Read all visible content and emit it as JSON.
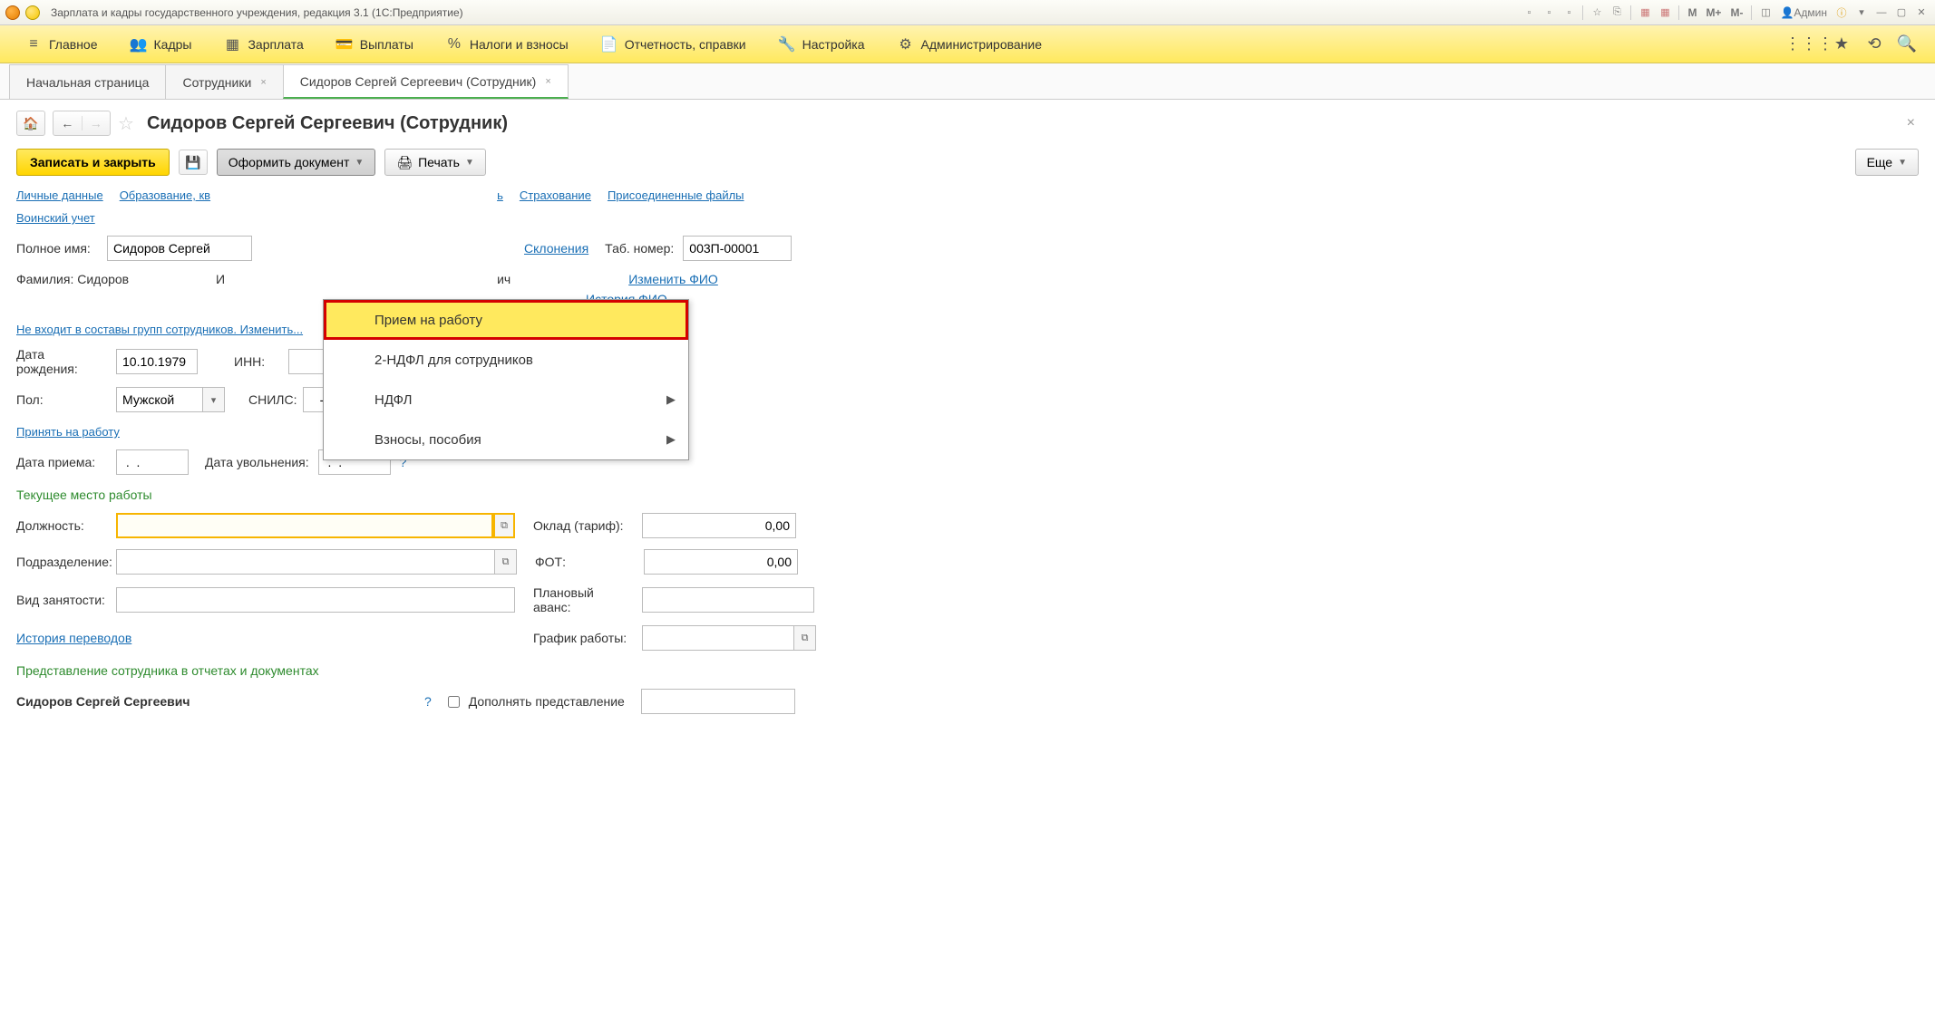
{
  "titlebar": {
    "title": "Зарплата и кадры государственного учреждения, редакция 3.1  (1С:Предприятие)",
    "user_label": "Админ",
    "m": "M",
    "mp": "M+",
    "mm": "M-"
  },
  "mainmenu": {
    "items": [
      {
        "icon": "≡",
        "label": "Главное"
      },
      {
        "icon": "👥",
        "label": "Кадры"
      },
      {
        "icon": "▦",
        "label": "Зарплата"
      },
      {
        "icon": "💳",
        "label": "Выплаты"
      },
      {
        "icon": "%",
        "label": "Налоги и взносы"
      },
      {
        "icon": "📄",
        "label": "Отчетность, справки"
      },
      {
        "icon": "🔧",
        "label": "Настройка"
      },
      {
        "icon": "⚙",
        "label": "Администрирование"
      }
    ],
    "right_icons": [
      "⋮⋮⋮",
      "★",
      "⟲",
      "🔍"
    ]
  },
  "tabs": [
    {
      "label": "Начальная страница",
      "closable": false,
      "active": false
    },
    {
      "label": "Сотрудники",
      "closable": true,
      "active": false
    },
    {
      "label": "Сидоров Сергей Сергеевич (Сотрудник)",
      "closable": true,
      "active": true
    }
  ],
  "page": {
    "title": "Сидоров Сергей Сергеевич (Сотрудник)",
    "btn_save_close": "Записать и закрыть",
    "btn_doc": "Оформить документ",
    "btn_print": "Печать",
    "btn_more": "Еще"
  },
  "dropdown": {
    "items": [
      {
        "label": "Прием на работу",
        "hi": true
      },
      {
        "label": "2-НДФЛ для сотрудников"
      },
      {
        "label": "НДФЛ",
        "sub": true
      },
      {
        "label": "Взносы, пособия",
        "sub": true
      }
    ]
  },
  "links": {
    "personal": "Личные данные",
    "edu": "Образование, кв",
    "family_end": "ь",
    "insurance": "Страхование",
    "files": "Присоединенные файлы",
    "military": "Воинский учет",
    "declensions": "Склонения",
    "change_fio": "Изменить ФИО",
    "history_fio": "История ФИО",
    "groups": "Не входит в составы групп сотрудников. Изменить...",
    "hire": "Принять на работу",
    "transfers": "История переводов"
  },
  "form": {
    "fullname_lbl": "Полное имя:",
    "fullname_val": "Сидоров Сергей",
    "tabnum_lbl": "Таб. номер:",
    "tabnum_val": "003П-00001",
    "surname_lbl": "Фамилия: Сидоров",
    "name_lbl": "И",
    "patr_end": "ич",
    "dob_lbl": "Дата рождения:",
    "dob_val": "10.10.1979",
    "inn_lbl": "ИНН:",
    "inn_val": "",
    "gender_lbl": "Пол:",
    "gender_val": "Мужской",
    "snils_lbl": "СНИЛС:",
    "snils_val": "   -   -",
    "hiredate_lbl": "Дата приема:",
    "hiredate_val": " .  .",
    "firedate_lbl": "Дата увольнения:",
    "firedate_val": " .  .",
    "workplace_hdr": "Текущее место работы",
    "position_lbl": "Должность:",
    "salary_lbl": "Оклад (тариф):",
    "salary_val": "0,00",
    "dept_lbl": "Подразделение:",
    "fot_lbl": "ФОТ:",
    "fot_val": "0,00",
    "emptype_lbl": "Вид занятости:",
    "advance_lbl": "Плановый аванс:",
    "schedule_lbl": "График работы:",
    "repr_hdr": "Представление сотрудника в отчетах и документах",
    "repr_val": "Сидоров Сергей Сергеевич",
    "extend_lbl": "Дополнять представление"
  }
}
